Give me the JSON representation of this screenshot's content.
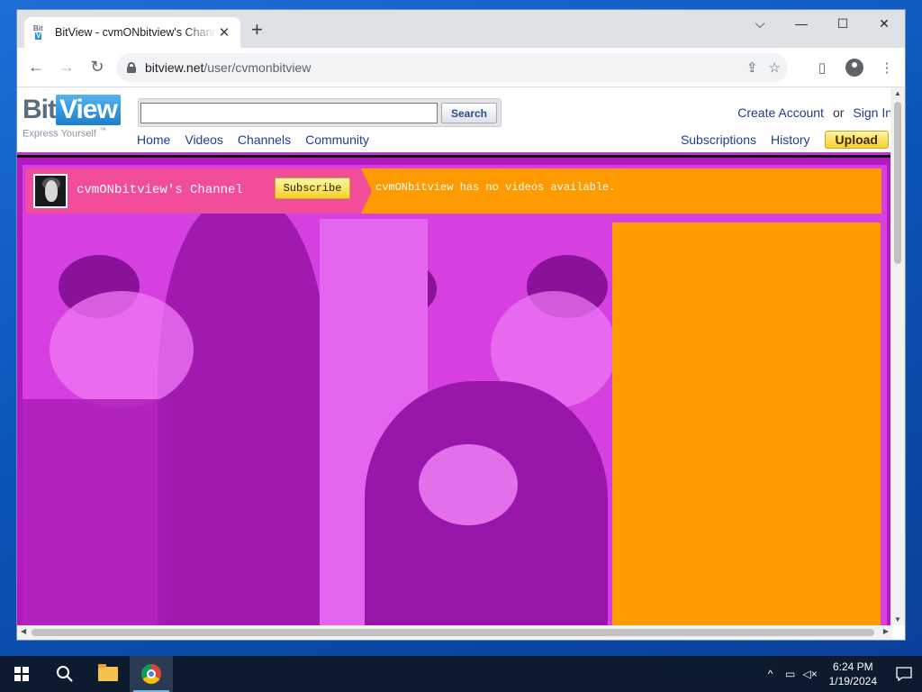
{
  "browser": {
    "tab_title": "BitView - cvmONbitview's Channel",
    "tab_close": "✕",
    "new_tab": "+",
    "url_host": "bitview.net",
    "url_path": "/user/cvmonbitview",
    "window_controls": {
      "dropdown": "⌵",
      "minimize": "—",
      "maximize": "☐",
      "close": "✕"
    }
  },
  "site": {
    "logo_bit": "Bit",
    "logo_view": "View",
    "tagline": "Express Yourself",
    "tagline_tm": "™",
    "search_value": "",
    "search_button": "Search",
    "nav": [
      "Home",
      "Videos",
      "Channels",
      "Community"
    ],
    "create_account": "Create Account",
    "or": "or",
    "sign_in": "Sign In",
    "subscriptions": "Subscriptions",
    "history": "History",
    "upload": "Upload"
  },
  "channel": {
    "title": "cvmONbitview's Channel",
    "subscribe": "Subscribe",
    "no_videos": "cvmONbitview has no videos available."
  },
  "taskbar": {
    "time": "6:24 PM",
    "date": "1/19/2024"
  },
  "colors": {
    "banner_orange": "#ff9a00",
    "banner_pink": "#f24d9a",
    "background_magenta": "#d63fe0",
    "link_blue": "#1e3f8c"
  }
}
